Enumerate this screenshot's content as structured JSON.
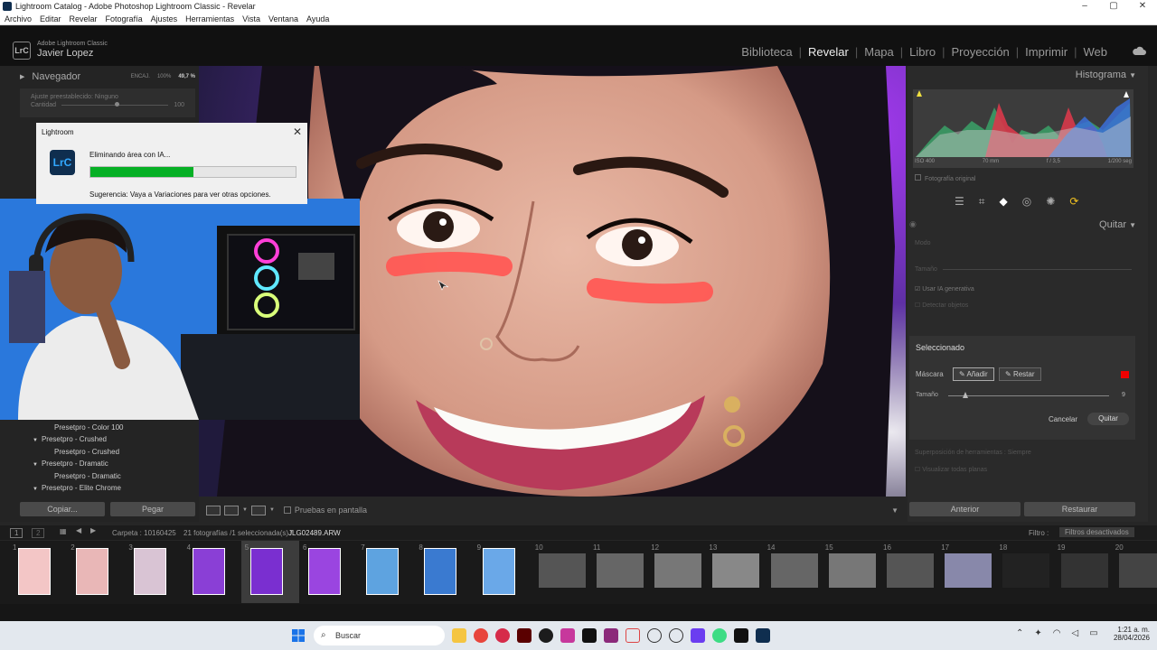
{
  "window": {
    "title": "Lightroom Catalog - Adobe Photoshop Lightroom Classic - Revelar",
    "minimize": "–",
    "maximize": "▢",
    "close": "✕"
  },
  "menu": [
    "Archivo",
    "Editar",
    "Revelar",
    "Fotografía",
    "Ajustes",
    "Herramientas",
    "Vista",
    "Ventana",
    "Ayuda"
  ],
  "identity": {
    "badge": "LrC",
    "app": "Adobe Lightroom Classic",
    "user": "Javier Lopez"
  },
  "modules": [
    "Biblioteca",
    "Revelar",
    "Mapa",
    "Libro",
    "Proyección",
    "Imprimir",
    "Web"
  ],
  "navigator": {
    "label": "Navegador",
    "fit": "ENCAJ.",
    "z1": "100%",
    "z2": "49,7 %",
    "preset_label": "Ajuste preestablecido",
    "preset_value": "Ninguno",
    "amount_label": "Cantidad",
    "amount_value": "100"
  },
  "dialog": {
    "title": "Lightroom",
    "icon": "LrC",
    "message": "Eliminando área con IA...",
    "progress": 0.5,
    "tip": "Sugerencia: Vaya a Variaciones para ver otras opciones."
  },
  "presets": [
    "Presetpro - Color 100",
    "Presetpro - Crushed",
    "Presetpro - Crushed",
    "Presetpro - Dramatic",
    "Presetpro - Dramatic",
    "Presetpro - Elite Chrome"
  ],
  "left_buttons": {
    "copy": "Copiar...",
    "paste": "Pegar"
  },
  "toolbar": {
    "softproof": "Pruebas en pantalla"
  },
  "histogram": {
    "label": "Histograma",
    "iso": "ISO 400",
    "focal": "70 mm",
    "aperture": "f / 3,5",
    "shutter": "1/200 seg",
    "original": "Fotografía original"
  },
  "quitar": {
    "label": "Quitar",
    "mode": "Modo",
    "size": "Tamaño",
    "generative": "Usar IA generativa",
    "detect": "Detectar objetos"
  },
  "selected": {
    "title": "Seleccionado",
    "mask_label": "Máscara",
    "add": "Añadir",
    "subtract": "Restar",
    "size_label": "Tamaño",
    "size_value": "9",
    "cancel": "Cancelar",
    "apply": "Quitar"
  },
  "overlay": {
    "label": "Superposición de herramientas",
    "value": "Siempre",
    "visualize": "Visualizar todas planas"
  },
  "nav_buttons": {
    "prev": "Anterior",
    "reset": "Restaurar"
  },
  "filmstrip": {
    "pages": [
      "1",
      "2"
    ],
    "folder": "Carpeta : 10160425",
    "count": "21 fotografías /1 seleccionada(s) /",
    "file": "JLG02489.ARW",
    "filter_label": "Filtro :",
    "filter_value": "Filtros desactivados",
    "numbers": [
      "1",
      "2",
      "3",
      "4",
      "5",
      "6",
      "7",
      "8",
      "9",
      "10",
      "11",
      "12",
      "13",
      "14",
      "15",
      "16",
      "17",
      "18",
      "19",
      "20"
    ]
  },
  "taskbar": {
    "search": "Buscar",
    "time": "1:21 a. m.",
    "date": "28/04/2026"
  },
  "colors": {
    "accent": "#06b025",
    "mask_red": "#e00000",
    "panel": "#2a2a2a"
  }
}
